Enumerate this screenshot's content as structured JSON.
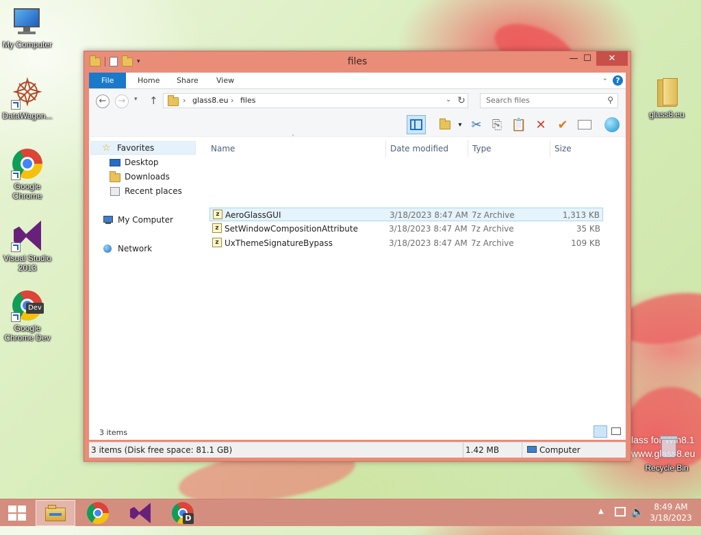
{
  "desktop": {
    "icons_left": [
      {
        "label_line1": "My Computer",
        "label_line2": ""
      },
      {
        "label_line1": "DataWagon...",
        "label_line2": ""
      },
      {
        "label_line1": "Google",
        "label_line2": "Chrome"
      },
      {
        "label_line1": "Visual Studio",
        "label_line2": "2013"
      },
      {
        "label_line1": "Google",
        "label_line2": "Chrome Dev"
      }
    ],
    "icons_right": [
      {
        "label": "glass8.eu"
      },
      {
        "label": "Recycle Bin"
      }
    ],
    "watermark": {
      "line1": "lass for Win8.1",
      "line2": "www.glass8.eu"
    }
  },
  "window": {
    "title": "files",
    "controls": {
      "minimize": "—",
      "maximize": "☐",
      "close": "✕"
    },
    "ribbon_tabs": [
      "File",
      "Home",
      "Share",
      "View"
    ],
    "address": {
      "segments": [
        "glass8.eu",
        "files"
      ]
    },
    "search": {
      "placeholder": "Search files"
    },
    "nav": {
      "favorites": "Favorites",
      "items": [
        "Desktop",
        "Downloads",
        "Recent places"
      ],
      "my_computer": "My Computer",
      "network": "Network"
    },
    "columns": [
      "Name",
      "Date modified",
      "Type",
      "Size"
    ],
    "files": [
      {
        "name": "AeroGlassGUI",
        "date": "3/18/2023 8:47 AM",
        "type": "7z Archive",
        "size": "1,313 KB",
        "selected": true
      },
      {
        "name": "SetWindowCompositionAttribute",
        "date": "3/18/2023 8:47 AM",
        "type": "7z Archive",
        "size": "35 KB",
        "selected": false
      },
      {
        "name": "UxThemeSignatureBypass",
        "date": "3/18/2023 8:47 AM",
        "type": "7z Archive",
        "size": "109 KB",
        "selected": false
      }
    ],
    "item_count": "3 items",
    "status": {
      "left": "3 items (Disk free space: 81.1 GB)",
      "size": "1.42 MB",
      "location": "Computer"
    }
  },
  "taskbar": {
    "apps": [
      "file-explorer",
      "google-chrome",
      "visual-studio",
      "chrome-dev"
    ],
    "clock": {
      "time": "8:49 AM",
      "date": "3/18/2023"
    }
  },
  "colors": {
    "window_frame": "#e98c78",
    "accent_blue": "#1979ca",
    "taskbar": "#d48e7f",
    "close_button": "#c7504a"
  }
}
